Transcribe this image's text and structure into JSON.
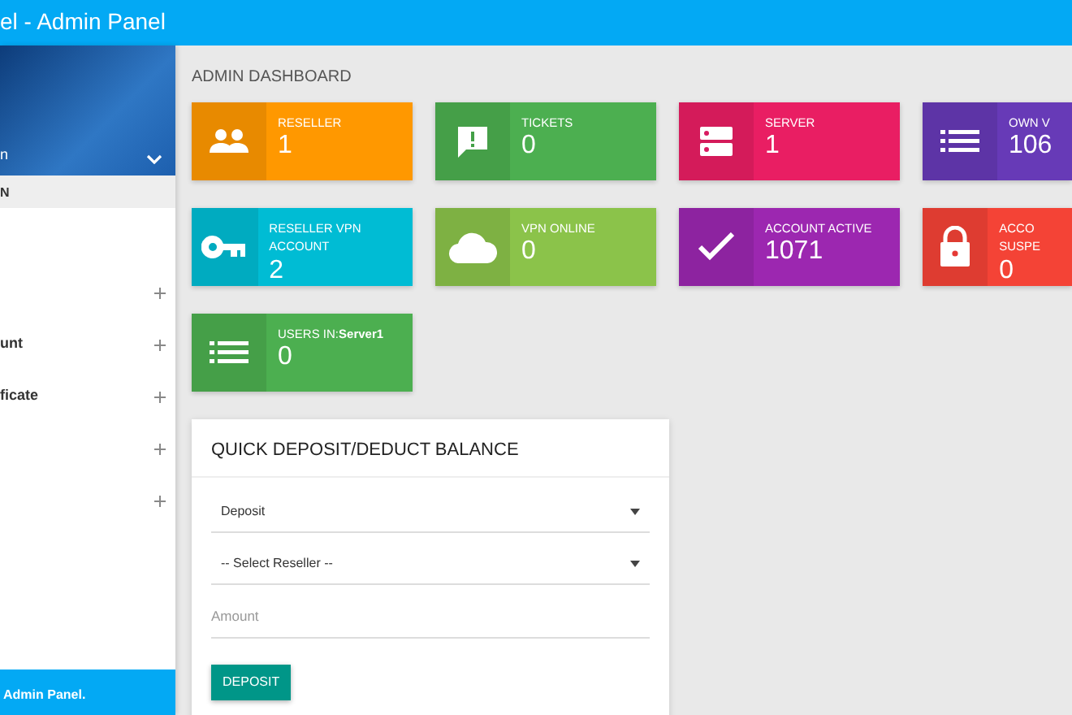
{
  "topbar": {
    "title": "el - Admin Panel"
  },
  "sidebar": {
    "profile": {
      "name": "n"
    },
    "section": "N",
    "items": [
      {
        "expandable": true
      },
      {
        "label": "unt",
        "expandable": true
      },
      {
        "label": "ficate",
        "expandable": true
      },
      {
        "expandable": true
      },
      {
        "expandable": true
      }
    ],
    "footer": "Admin Panel."
  },
  "page_title": "ADMIN DASHBOARD",
  "stats": [
    {
      "kind": "people",
      "label": "RESELLER",
      "value": "1",
      "color": "#ff9800"
    },
    {
      "kind": "chat",
      "label": "TICKETS",
      "value": "0",
      "color": "#4caf50"
    },
    {
      "kind": "server",
      "label": "SERVER",
      "value": "1",
      "color": "#e91e63"
    },
    {
      "kind": "list",
      "label": "OWN V",
      "value": "106",
      "color": "#673ab7"
    },
    {
      "kind": "key",
      "label": "RESELLER VPN ACCOUNT",
      "value": "2",
      "color": "#00bcd4"
    },
    {
      "kind": "cloud",
      "label": "VPN ONLINE",
      "value": "0",
      "color": "#8bc34a"
    },
    {
      "kind": "check",
      "label": "ACCOUNT ACTIVE",
      "value": "1071",
      "color": "#9c27b0"
    },
    {
      "kind": "lock",
      "label": "ACCO SUSPE",
      "value": "0",
      "color": "#f44336"
    },
    {
      "kind": "list",
      "label": "USERS IN:**Server1**",
      "value": "0",
      "color": "#4caf50"
    }
  ],
  "deposit": {
    "title": "QUICK DEPOSIT/DEDUCT BALANCE",
    "type_select": "Deposit",
    "reseller_select": "-- Select Reseller --",
    "amount": {
      "placeholder": "Amount"
    },
    "button": "DEPOSIT"
  }
}
